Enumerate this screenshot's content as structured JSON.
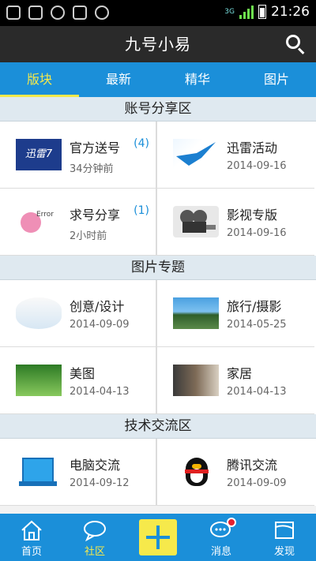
{
  "status_bar": {
    "time": "21:26",
    "network_label": "3G"
  },
  "header": {
    "title": "九号小易",
    "search_icon": "search-icon"
  },
  "tabs": [
    {
      "label": "版块",
      "active": true
    },
    {
      "label": "最新",
      "active": false
    },
    {
      "label": "精华",
      "active": false
    },
    {
      "label": "图片",
      "active": false
    }
  ],
  "sections": [
    {
      "title": "账号分享区",
      "items": [
        {
          "name": "官方送号",
          "count": "(4)",
          "meta": "34分钟前",
          "thumb_text": "迅雷7"
        },
        {
          "name": "迅雷活动",
          "count": "",
          "meta": "2014-09-16"
        },
        {
          "name": "求号分享",
          "count": "(1)",
          "meta": "2小时前",
          "thumb_text": "Error"
        },
        {
          "name": "影视专版",
          "count": "",
          "meta": "2014-09-16"
        }
      ]
    },
    {
      "title": "图片专题",
      "items": [
        {
          "name": "创意/设计",
          "meta": "2014-09-09"
        },
        {
          "name": "旅行/摄影",
          "meta": "2014-05-25"
        },
        {
          "name": "美图",
          "meta": "2014-04-13"
        },
        {
          "name": "家居",
          "meta": "2014-04-13"
        }
      ]
    },
    {
      "title": "技术交流区",
      "items": [
        {
          "name": "电脑交流",
          "meta": "2014-09-12"
        },
        {
          "name": "腾讯交流",
          "meta": "2014-09-09"
        }
      ]
    }
  ],
  "bottom_nav": [
    {
      "label": "首页",
      "icon": "home-icon",
      "active": false
    },
    {
      "label": "社区",
      "icon": "chat-bubble-icon",
      "active": true
    },
    {
      "label": "",
      "icon": "plus-icon",
      "active": false
    },
    {
      "label": "消息",
      "icon": "message-icon",
      "active": false
    },
    {
      "label": "发现",
      "icon": "map-icon",
      "active": false
    }
  ],
  "colors": {
    "accent": "#1b8fd9",
    "active_tab": "#f6e94b",
    "title_bar": "#2a2a2a"
  }
}
